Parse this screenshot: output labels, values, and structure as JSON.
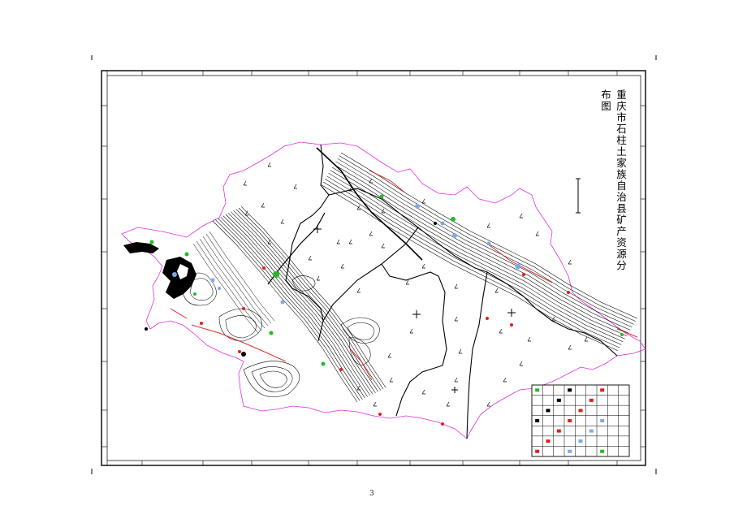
{
  "map": {
    "title": "重庆市石柱土家族自治县矿产资源分布图",
    "page_number": "3",
    "colors": {
      "county_boundary": "#e030e0",
      "fault_line": "#e03030",
      "contour": "#000000",
      "marker_blue": "#7fa8e6",
      "marker_green": "#22bb22",
      "marker_red": "#dd2020",
      "frame": "#000000"
    },
    "legend": {
      "rows": 7,
      "columns": 9,
      "symbol_colors": [
        "#22bb22",
        "#7fa8e6",
        "#dd2020",
        "#000000"
      ]
    },
    "icons": [
      "scale-bar-icon",
      "crosshair-icon",
      "mine-marker-icon",
      "contour-lines"
    ]
  }
}
